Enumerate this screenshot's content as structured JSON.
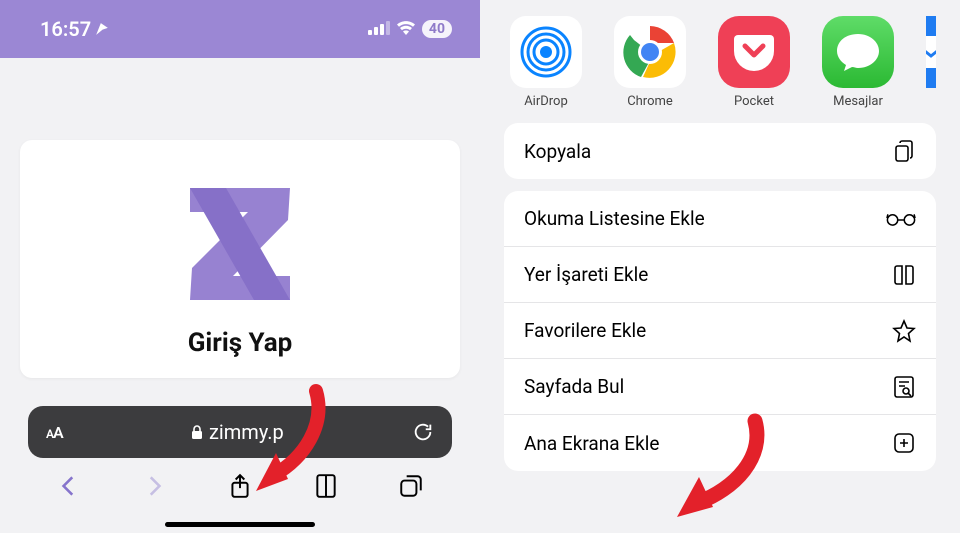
{
  "status": {
    "time": "16:57",
    "battery": "40"
  },
  "card": {
    "title": "Giriş Yap"
  },
  "urlbar": {
    "textsize": "AA",
    "url": "zimmy.p"
  },
  "share": {
    "items": [
      {
        "label": "AirDrop"
      },
      {
        "label": "Chrome"
      },
      {
        "label": "Pocket"
      },
      {
        "label": "Mesajlar"
      }
    ]
  },
  "actions1": [
    {
      "label": "Kopyala",
      "icon": "copy"
    }
  ],
  "actions2": [
    {
      "label": "Okuma Listesine Ekle",
      "icon": "glasses"
    },
    {
      "label": "Yer İşareti Ekle",
      "icon": "book"
    },
    {
      "label": "Favorilere Ekle",
      "icon": "star"
    },
    {
      "label": "Sayfada Bul",
      "icon": "find"
    },
    {
      "label": "Ana Ekrana Ekle",
      "icon": "plus-square"
    }
  ]
}
